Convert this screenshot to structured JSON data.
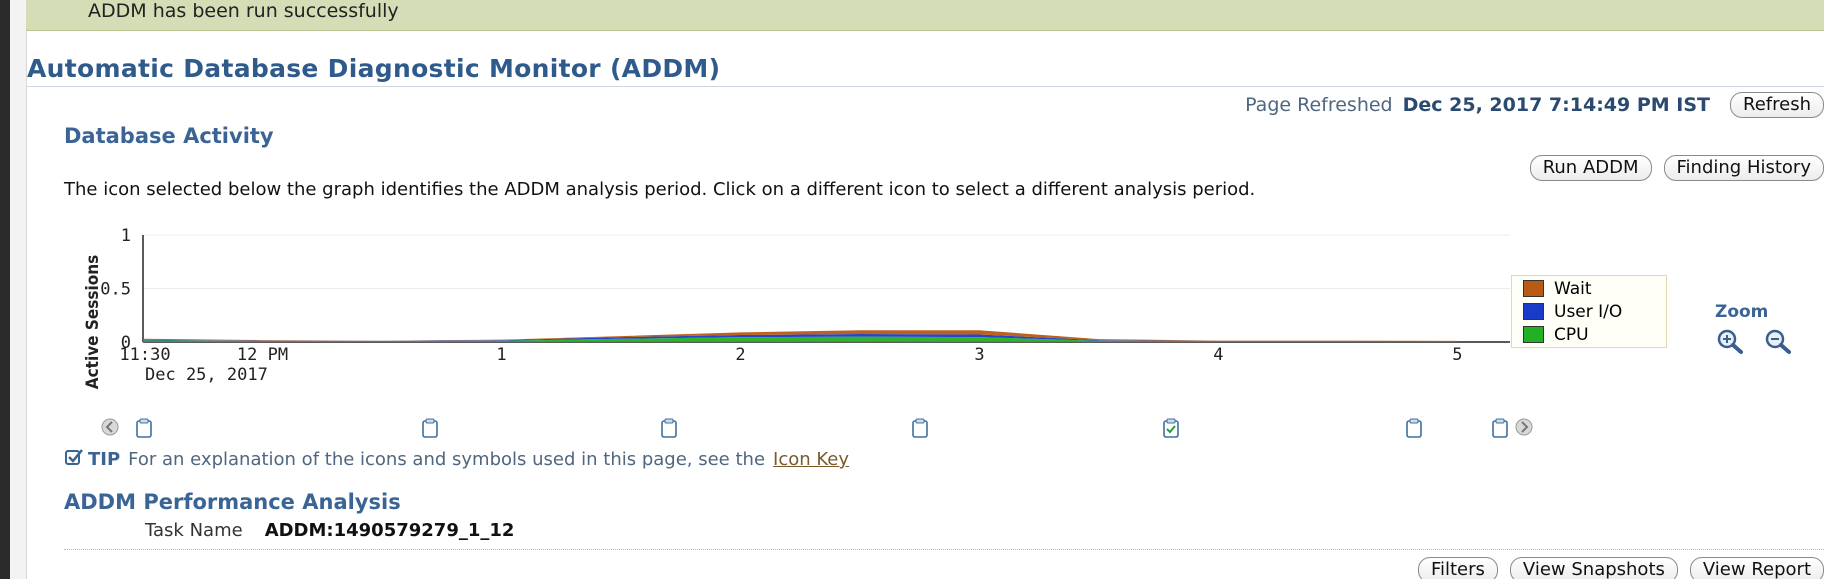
{
  "banner": {
    "message": "ADDM has been run successfully"
  },
  "page": {
    "title": "Automatic Database Diagnostic Monitor (ADDM)",
    "refreshed_label": "Page Refreshed",
    "refreshed_value": "Dec 25, 2017 7:14:49 PM IST",
    "refresh_button": "Refresh"
  },
  "activity": {
    "section_title": "Database Activity",
    "run_addm_button": "Run ADDM",
    "finding_history_button": "Finding History",
    "instructions": "The icon selected below the graph identifies the ADDM analysis period. Click on a different icon to select a different analysis period.",
    "zoom_label": "Zoom",
    "zoom_in_icon": "zoom-in-icon",
    "zoom_out_icon": "zoom-out-icon"
  },
  "chart_data": {
    "type": "area",
    "title": "",
    "ylabel": "Active Sessions",
    "xlabel": "",
    "ylim": [
      0,
      1
    ],
    "y_ticks": [
      "0",
      "0.5",
      "1"
    ],
    "x_ticks": [
      "11:30",
      "12 PM",
      "1",
      "2",
      "3",
      "4",
      "5"
    ],
    "x_subtitle": "Dec 25, 2017",
    "x": [
      0,
      0.5,
      1,
      1.5,
      2,
      2.5,
      3,
      3.5,
      4,
      4.5,
      5,
      5.5
    ],
    "series": [
      {
        "name": "Wait",
        "color": "#b85a14",
        "values": [
          0.01,
          0.005,
          0.002,
          0.005,
          0.01,
          0.025,
          0.035,
          0.04,
          0.01,
          0.003,
          0.003,
          0.002
        ]
      },
      {
        "name": "User I/O",
        "color": "#1a3ac8",
        "values": [
          0.005,
          0.003,
          0.002,
          0.005,
          0.015,
          0.02,
          0.025,
          0.025,
          0.005,
          0.002,
          0.002,
          0.002
        ]
      },
      {
        "name": "CPU",
        "color": "#22b024",
        "values": [
          0.015,
          0.01,
          0.008,
          0.012,
          0.03,
          0.045,
          0.05,
          0.045,
          0.012,
          0.008,
          0.008,
          0.006
        ]
      }
    ],
    "legend": "right",
    "grid": false
  },
  "snapshot_icons": [
    {
      "kind": "scroll-left-icon",
      "x": 0
    },
    {
      "kind": "snapshot-icon",
      "x": 0
    },
    {
      "kind": "snapshot-icon",
      "x": 1
    },
    {
      "kind": "snapshot-icon",
      "x": 2
    },
    {
      "kind": "snapshot-icon",
      "x": 3
    },
    {
      "kind": "snapshot-selected-icon",
      "x": 4
    },
    {
      "kind": "snapshot-icon",
      "x": 5
    },
    {
      "kind": "snapshot-icon",
      "x": 5.45
    },
    {
      "kind": "scroll-right-icon",
      "x": 5.45
    }
  ],
  "tip": {
    "label": "TIP",
    "text": "For an explanation of the icons and symbols used in this page, see the",
    "link": "Icon Key"
  },
  "performance": {
    "section_title": "ADDM Performance Analysis",
    "task_label": "Task Name",
    "task_value": "ADDM:1490579279_1_12",
    "filters_button": "Filters",
    "view_snapshots_button": "View Snapshots",
    "view_report_button": "View Report"
  },
  "colors": {
    "title": "#2f5a8c",
    "section": "#3a6496",
    "banner": "#d5ddb7"
  }
}
